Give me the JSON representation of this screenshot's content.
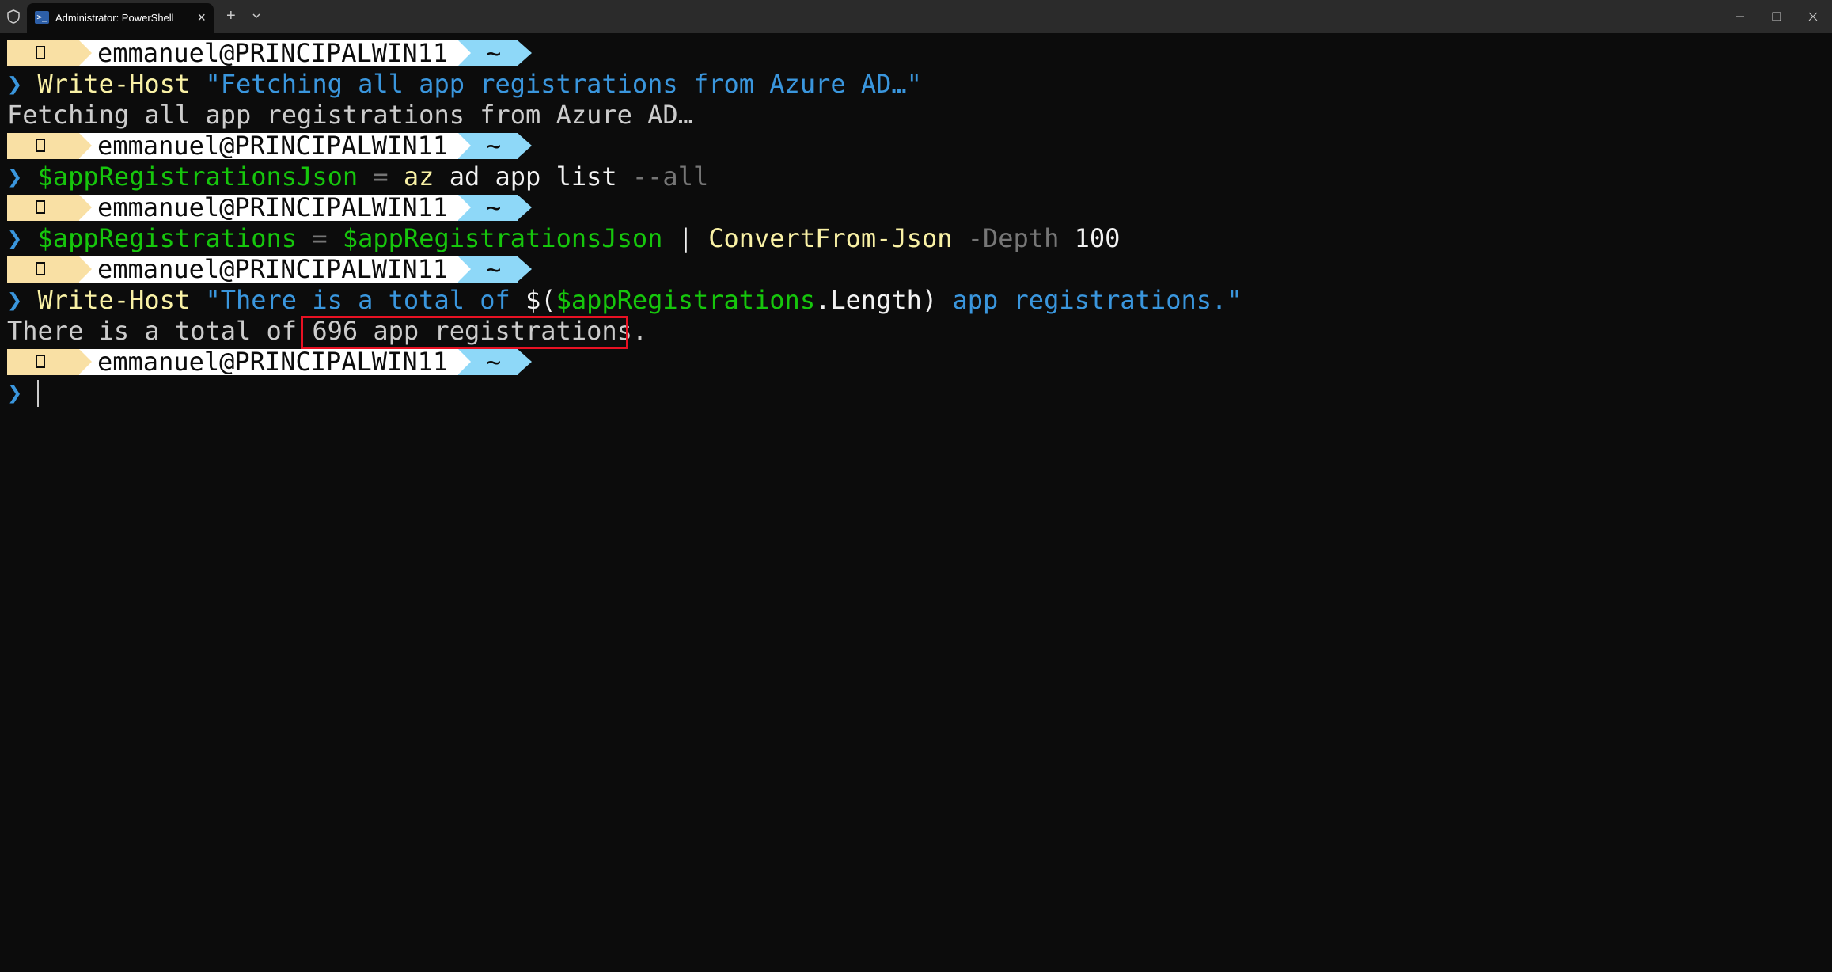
{
  "window": {
    "tab_title": "Administrator: PowerShell",
    "tab_close": "×",
    "new_tab": "+",
    "ps_icon": ">_"
  },
  "prompt": {
    "user": "emmanuel@PRINCIPALWIN11",
    "dir": "~",
    "chevron": "❯"
  },
  "lines": {
    "cmd1": {
      "cmd": "Write-Host",
      "arg": "\"Fetching all app registrations from Azure AD…\""
    },
    "out1": "Fetching all app registrations from Azure AD…",
    "cmd2": {
      "var": "$appRegistrationsJson",
      "eq": "=",
      "cmd": "az",
      "rest": "ad app list",
      "param": "--all"
    },
    "cmd3": {
      "var": "$appRegistrations",
      "eq": "=",
      "var2": "$appRegistrationsJson",
      "pipe": "|",
      "cmd": "ConvertFrom-Json",
      "param": "-Depth",
      "num": "100"
    },
    "cmd4": {
      "cmd": "Write-Host",
      "str1": "\"There is a total of",
      "sub_open": "$(",
      "var": "$appRegistrations",
      "prop": ".Length)",
      "str2": "app registrations.\""
    },
    "out2": "There is a total of 696 app registrations."
  },
  "colors": {
    "prompt_yellow": "#f9e0a4",
    "prompt_white": "#ffffff",
    "prompt_blue": "#8ed8f8",
    "highlight_box": "#e81123"
  }
}
